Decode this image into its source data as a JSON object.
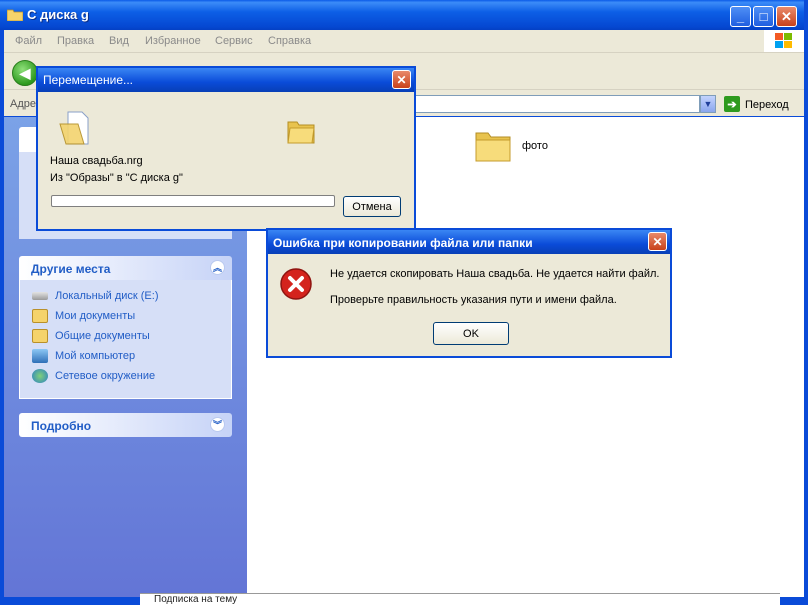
{
  "window": {
    "title": "С диска g"
  },
  "menubar": {
    "items": [
      "Файл",
      "Правка",
      "Вид",
      "Избранное",
      "Сервис",
      "Справка"
    ]
  },
  "addressbar": {
    "label": "Адре",
    "go_label": "Переход"
  },
  "sidebar": {
    "panes": [
      {
        "title": "Другие места",
        "items": [
          "Локальный диск (E:)",
          "Мои документы",
          "Общие документы",
          "Мой компьютер",
          "Сетевое окружение"
        ]
      },
      {
        "title": "Подробно"
      }
    ]
  },
  "content": {
    "folders": [
      {
        "name": "фото"
      }
    ]
  },
  "move_dialog": {
    "title": "Перемещение...",
    "file_name": "Наша свадьба.nrg",
    "from_to": "Из \"Образы\" в \"С диска g\"",
    "progress": 0,
    "cancel_label": "Отмена"
  },
  "error_dialog": {
    "title": "Ошибка при копировании файла или папки",
    "message": "Не удается скопировать Наша свадьба. Не удается найти файл.",
    "hint": "Проверьте правильность указания пути и имени файла.",
    "ok_label": "OK"
  },
  "status": {
    "bottom_text": "Подписка на тему"
  },
  "colors": {
    "titlebar": "#0a4bd8",
    "link": "#215dc6",
    "dialog_bg": "#ece9d8",
    "error_red": "#d4231d"
  },
  "icons": [
    "folder-icon",
    "back-arrow-icon",
    "go-arrow-icon",
    "error-icon",
    "drive-icon",
    "my-computer-icon",
    "network-icon"
  ]
}
